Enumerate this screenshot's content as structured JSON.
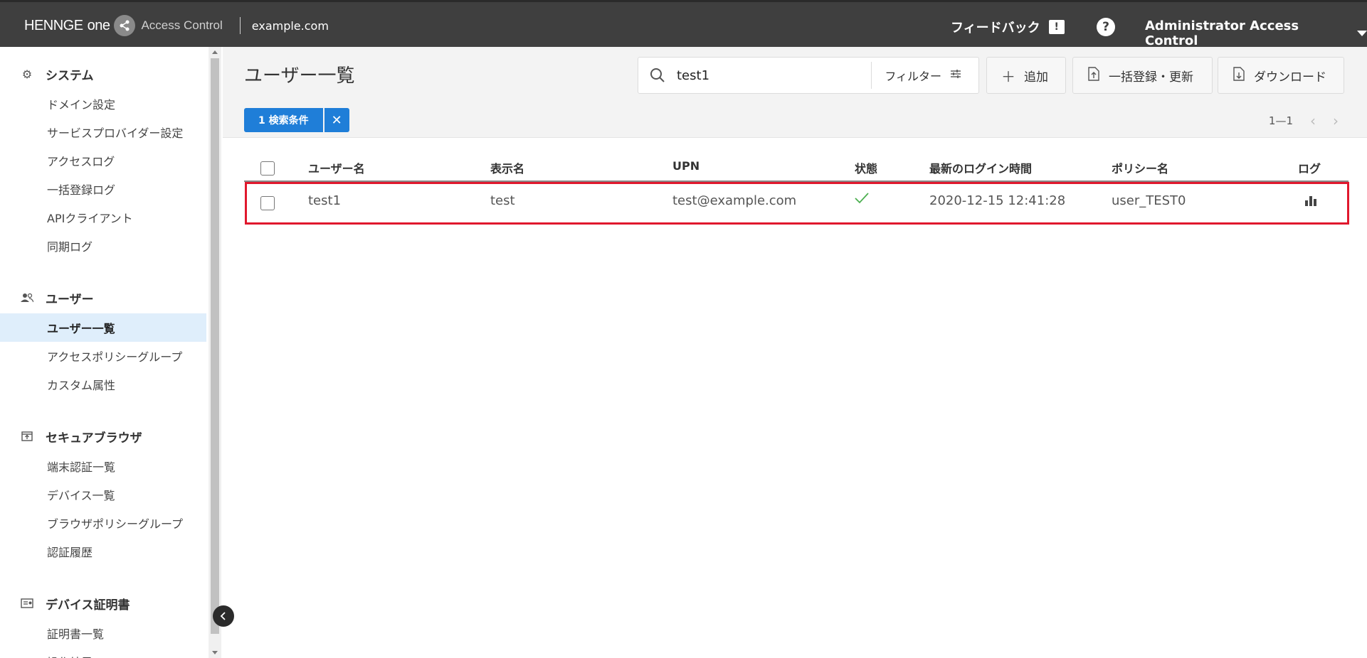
{
  "topbar": {
    "brand_word": "HENNGE",
    "brand_word2": "one",
    "product": "Access Control",
    "domain": "example.com",
    "feedback": "フィードバック",
    "help": "?",
    "admin": "Administrator Access Control"
  },
  "sidebar": {
    "sections": [
      {
        "title": "システム",
        "icon": "gear-icon",
        "items": [
          "ドメイン設定",
          "サービスプロバイダー設定",
          "アクセスログ",
          "一括登録ログ",
          "APIクライアント",
          "同期ログ"
        ]
      },
      {
        "title": "ユーザー",
        "icon": "users-icon",
        "items": [
          "ユーザー一覧",
          "アクセスポリシーグループ",
          "カスタム属性"
        ],
        "active": "ユーザー一覧"
      },
      {
        "title": "セキュアブラウザ",
        "icon": "browser-icon",
        "items": [
          "端末認証一覧",
          "デバイス一覧",
          "ブラウザポリシーグループ",
          "認証履歴"
        ]
      },
      {
        "title": "デバイス証明書",
        "icon": "certificate-icon",
        "items": [
          "証明書一覧",
          "操作結果"
        ]
      }
    ]
  },
  "header": {
    "title": "ユーザー一覧",
    "search_value": "test1",
    "filter_label": "フィルター",
    "add_label": "追加",
    "bulk_label": "一括登録・更新",
    "download_label": "ダウンロード",
    "chip_label": "1 検索条件",
    "pager": "1—1"
  },
  "table": {
    "columns": [
      "ユーザー名",
      "表示名",
      "UPN",
      "状態",
      "最新のログイン時間",
      "ポリシー名",
      "ログ"
    ],
    "rows": [
      {
        "username": "test1",
        "display": "test",
        "upn": "test@example.com",
        "status": "active",
        "last_login": "2020-12-15 12:41:28",
        "policy": "user_TEST0",
        "log": "chart-icon"
      }
    ]
  },
  "colors": {
    "topbar": "#3f3f3f",
    "accent": "#1f7ed8",
    "highlight": "#e0182d",
    "active_bg": "#dfeefb",
    "status_ok": "#4caf50"
  }
}
